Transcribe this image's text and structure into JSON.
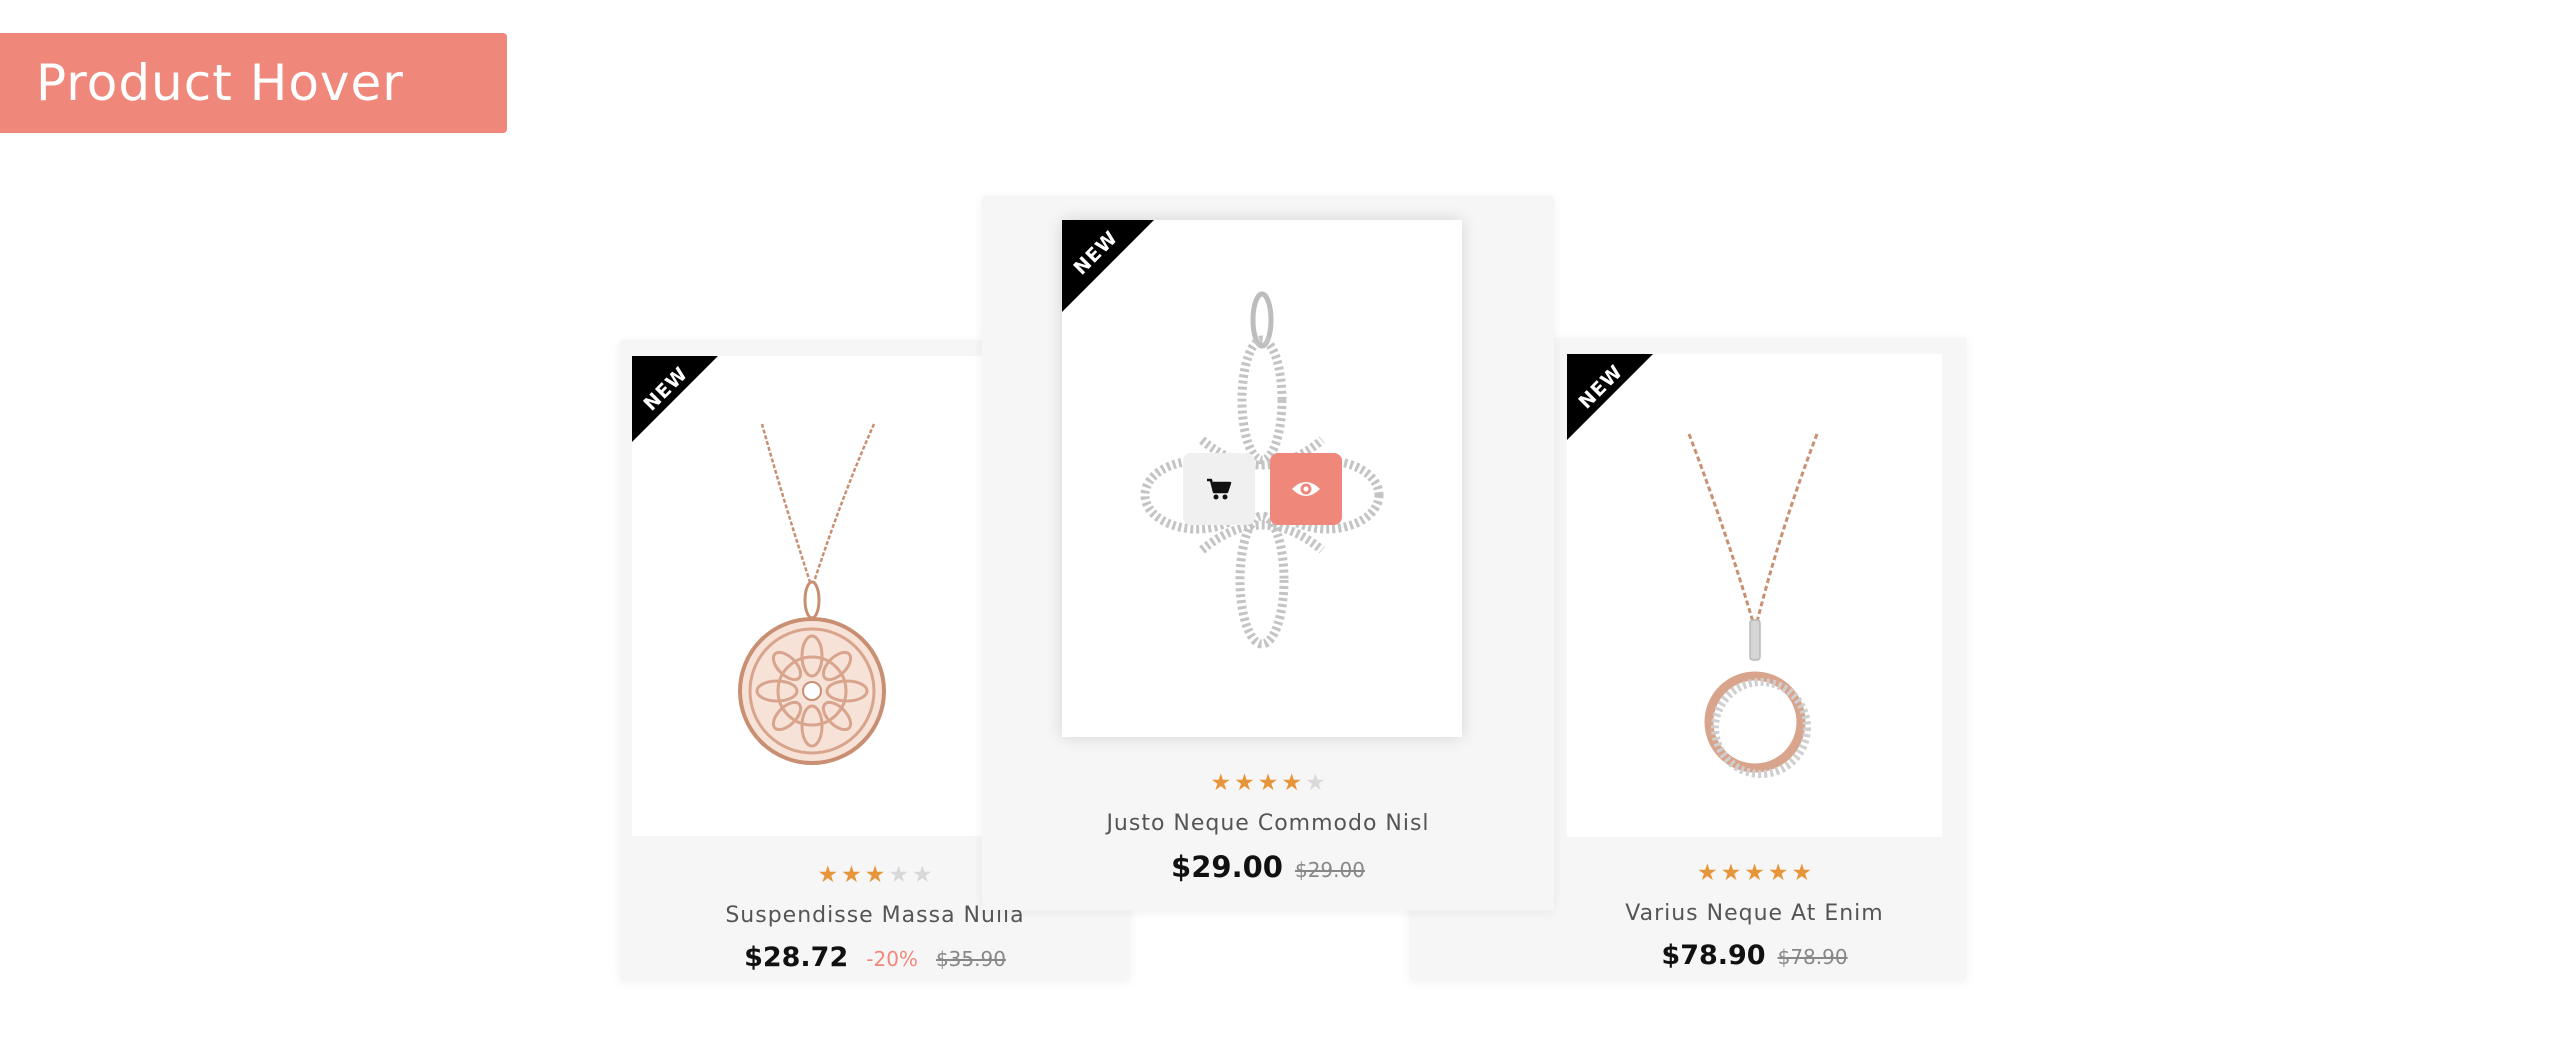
{
  "header": {
    "title": "Product Hover"
  },
  "colors": {
    "accent": "#f0877b",
    "star_on": "#e6953b",
    "star_off": "#d9d9d9",
    "ribbon": "#000000",
    "card_bg": "#f6f6f6"
  },
  "products": [
    {
      "ribbon": "NEW",
      "image": "rose-gold-filigree-disc-pendant",
      "rating": 3,
      "rating_max": 5,
      "name": "Suspendisse Massa Nulla",
      "price": "$28.72",
      "discount": "-20%",
      "old_price": "$35.90"
    },
    {
      "ribbon": "NEW",
      "image": "silver-crystal-knot-pendant",
      "rating": 4,
      "rating_max": 5,
      "name": "Justo Neque Commodo Nisl",
      "price": "$29.00",
      "old_price": "$29.00",
      "actions": {
        "cart_icon": "cart-icon",
        "view_icon": "eye-icon"
      }
    },
    {
      "ribbon": "NEW",
      "image": "rose-gold-circle-pendant",
      "rating": 5,
      "rating_max": 5,
      "name": "Varius Neque At Enim",
      "price": "$78.90",
      "old_price": "$78.90"
    }
  ]
}
